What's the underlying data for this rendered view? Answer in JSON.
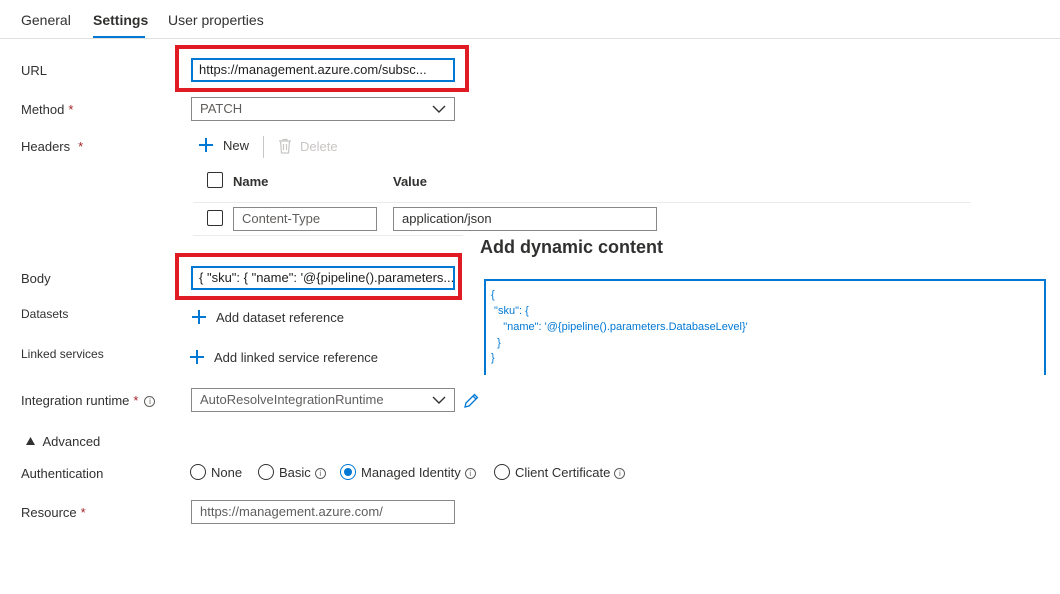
{
  "tabs": [
    {
      "label": "General"
    },
    {
      "label": "Settings"
    },
    {
      "label": "User properties"
    }
  ],
  "url": {
    "label": "URL",
    "value": "https://management.azure.com/subsc..."
  },
  "method": {
    "label": "Method",
    "required": "*",
    "value": "PATCH"
  },
  "headers": {
    "label": "Headers",
    "required": "*",
    "new_label": "New",
    "delete_label": "Delete",
    "col_name": "Name",
    "col_value": "Value",
    "row": {
      "name": "Content-Type",
      "value": "application/json"
    }
  },
  "body": {
    "label": "Body",
    "value": "{ \"sku\": { \"name\": '@{pipeline().parameters..."
  },
  "datasets": {
    "label": "Datasets",
    "action": "Add dataset reference"
  },
  "linked_services": {
    "label": "Linked services",
    "action": "Add linked service reference"
  },
  "integration_runtime": {
    "label": "Integration runtime",
    "required": "*",
    "value": "AutoResolveIntegrationRuntime"
  },
  "advanced": {
    "label": "Advanced"
  },
  "authentication": {
    "label": "Authentication",
    "options": [
      {
        "label": "None",
        "selected": false
      },
      {
        "label": "Basic",
        "selected": false
      },
      {
        "label": "Managed Identity",
        "selected": true
      },
      {
        "label": "Client Certificate",
        "selected": false
      }
    ]
  },
  "resource": {
    "label": "Resource",
    "required": "*",
    "value": "https://management.azure.com/"
  },
  "dynamic_content": {
    "title": "Add dynamic content",
    "lines": [
      "{",
      " \"sku\": {",
      "    \"name\": '@{pipeline().parameters.DatabaseLevel}'",
      "  }",
      "}"
    ]
  },
  "colors": {
    "accent": "#0078d4",
    "highlight": "#e01b24",
    "required": "#a4262c"
  },
  "icons": {
    "add": "plus-icon",
    "delete": "trash-icon",
    "dropdown": "chevron-down-icon",
    "edit": "pencil-icon",
    "info": "info-icon",
    "collapse": "triangle-icon"
  }
}
